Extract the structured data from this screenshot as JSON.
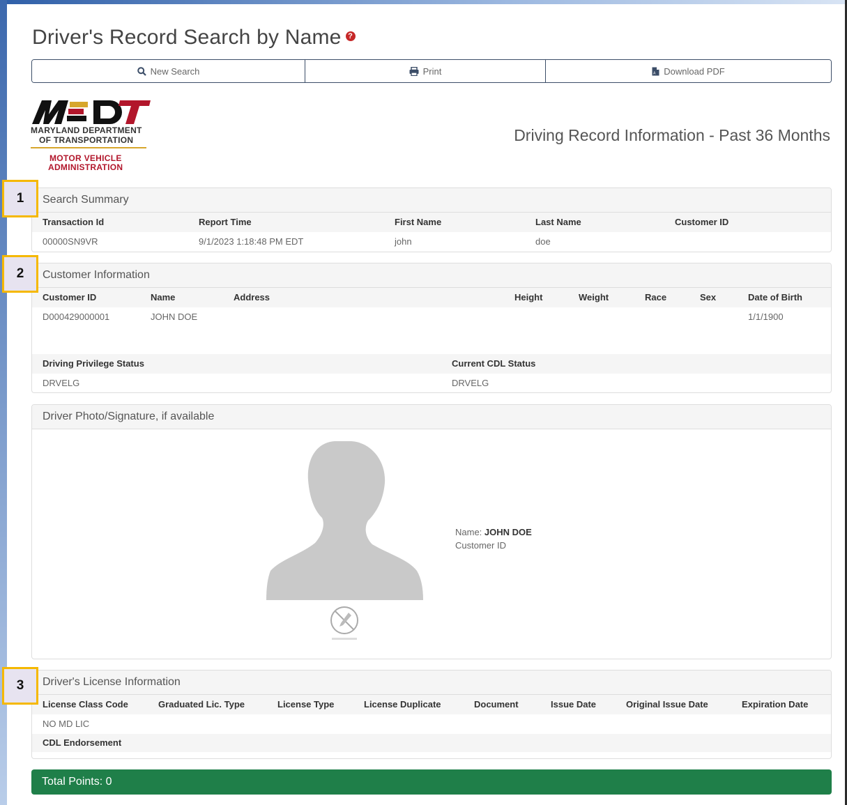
{
  "page": {
    "title": "Driver's Record Search by Name",
    "help_icon": "question-circle-icon",
    "report_title": "Driving Record Information - Past 36 Months"
  },
  "toolbar": {
    "new_search": "New Search",
    "print": "Print",
    "download_pdf": "Download PDF"
  },
  "logo": {
    "mark": "MDOT",
    "line1": "MARYLAND DEPARTMENT",
    "line2": "OF TRANSPORTATION",
    "line3": "MOTOR VEHICLE",
    "line4": "ADMINISTRATION"
  },
  "badges": [
    "1",
    "2",
    "3"
  ],
  "search_summary": {
    "title": "Search Summary",
    "headers": [
      "Transaction Id",
      "Report Time",
      "First Name",
      "Last Name",
      "Customer ID"
    ],
    "values": [
      "00000SN9VR",
      "9/1/2023 1:18:48 PM EDT",
      "john",
      "doe",
      ""
    ]
  },
  "customer_info": {
    "title": "Customer Information",
    "headers": [
      "Customer ID",
      "Name",
      "Address",
      "Height",
      "Weight",
      "Race",
      "Sex",
      "Date of Birth"
    ],
    "values": [
      "D000429000001",
      "JOHN DOE",
      "",
      "",
      "",
      "",
      "",
      "1/1/1900"
    ],
    "status_headers": [
      "Driving Privilege Status",
      "Current CDL Status"
    ],
    "status_values": [
      "DRVELG",
      "DRVELG"
    ]
  },
  "photo": {
    "title": "Driver Photo/Signature, if available",
    "name_label": "Name:",
    "name_value": "JOHN DOE",
    "customer_id_label": "Customer ID"
  },
  "license_info": {
    "title": "Driver's License Information",
    "headers": [
      "License Class Code",
      "Graduated Lic. Type",
      "License Type",
      "License Duplicate",
      "Document",
      "Issue Date",
      "Original Issue Date",
      "Expiration Date"
    ],
    "values": [
      "NO MD LIC"
    ],
    "cdl_endorsement": "CDL Endorsement"
  },
  "total_points": "Total Points: 0",
  "colors": {
    "toolbar_border": "#3b4d67",
    "badge_border": "#f5b800",
    "total_bar": "#1f7f49",
    "logo_red": "#b2162b",
    "logo_gold": "#d7a62c"
  }
}
